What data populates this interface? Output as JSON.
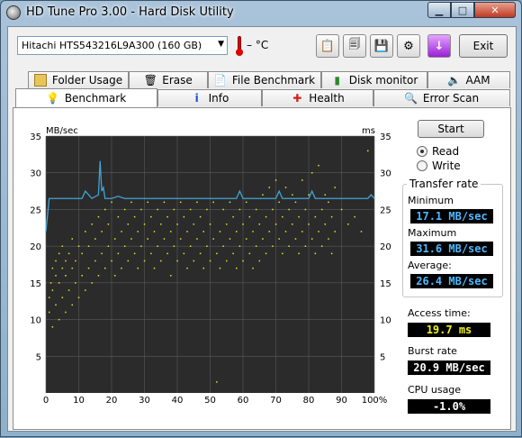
{
  "window": {
    "title": "HD Tune Pro 3.00 - Hard Disk Utility",
    "min": "▁",
    "max": "□",
    "close": "✕"
  },
  "toolbar": {
    "drive": "Hitachi HTS543216L9A300 (160 GB)",
    "temperature": "– °C",
    "exit_label": "Exit",
    "icons": [
      "copy-text-icon",
      "copy-screenshot-icon",
      "save-icon",
      "settings-icon",
      "download-icon"
    ]
  },
  "tabs": {
    "top": [
      "Folder Usage",
      "Erase",
      "File Benchmark",
      "Disk monitor",
      "AAM"
    ],
    "bottom": [
      "Benchmark",
      "Info",
      "Health",
      "Error Scan"
    ]
  },
  "benchmark": {
    "start_label": "Start",
    "read_label": "Read",
    "write_label": "Write",
    "mode": "Read",
    "transfer_rate_title": "Transfer rate",
    "minimum_label": "Minimum",
    "minimum_value": "17.1 MB/sec",
    "maximum_label": "Maximum",
    "maximum_value": "31.6 MB/sec",
    "average_label": "Average:",
    "average_value": "26.4 MB/sec",
    "access_label": "Access time:",
    "access_value": "19.7 ms",
    "burst_label": "Burst rate",
    "burst_value": "20.9 MB/sec",
    "cpu_label": "CPU usage",
    "cpu_value": "-1.0%"
  },
  "chart_data": {
    "type": "line",
    "y_left_label": "MB/sec",
    "y_right_label": "ms",
    "y_ticks": [
      5,
      10,
      15,
      20,
      25,
      30,
      35
    ],
    "x_ticks": [
      "0",
      "10",
      "20",
      "30",
      "40",
      "50",
      "60",
      "70",
      "80",
      "90",
      "100%"
    ],
    "ylim": [
      0,
      35
    ],
    "xlim": [
      0,
      100
    ],
    "colors": {
      "transfer": "#3fa4d8",
      "access": "#e6e620",
      "background": "#2b2b2b",
      "grid": "#5a5a5a"
    },
    "series": [
      {
        "x": [
          0,
          1,
          2,
          5,
          8,
          11,
          12,
          14,
          16,
          16.5,
          17,
          17.5,
          18,
          20,
          22,
          24,
          26,
          28,
          30,
          35,
          40,
          45,
          50,
          55,
          58,
          59,
          60,
          65,
          70,
          71,
          72,
          75,
          80,
          81,
          82,
          85,
          90,
          95,
          98,
          99,
          100
        ],
        "y": [
          22,
          26.5,
          26.5,
          26.5,
          26.5,
          26.5,
          27.5,
          26.5,
          27,
          31.6,
          27.5,
          28,
          26.5,
          26.5,
          26.8,
          26.5,
          26.5,
          26.5,
          26.5,
          26.5,
          26.5,
          26.5,
          26.5,
          26.5,
          26.5,
          27.5,
          26.5,
          26.5,
          26.5,
          27.5,
          26.5,
          26.5,
          26.5,
          27.5,
          26.5,
          26.5,
          26.5,
          26.5,
          26.5,
          27,
          26.5
        ]
      }
    ],
    "access_points": [
      [
        1,
        11
      ],
      [
        1,
        13
      ],
      [
        1.5,
        15
      ],
      [
        2,
        9
      ],
      [
        2,
        14
      ],
      [
        2,
        17
      ],
      [
        3,
        12
      ],
      [
        3,
        16
      ],
      [
        3,
        18
      ],
      [
        4,
        10
      ],
      [
        4,
        15
      ],
      [
        4,
        19
      ],
      [
        5,
        13
      ],
      [
        5,
        17
      ],
      [
        5,
        20
      ],
      [
        6,
        11
      ],
      [
        6,
        16
      ],
      [
        6,
        18
      ],
      [
        7,
        14
      ],
      [
        7,
        19
      ],
      [
        8,
        12
      ],
      [
        8,
        17
      ],
      [
        8,
        21
      ],
      [
        9,
        15
      ],
      [
        9,
        18
      ],
      [
        10,
        13
      ],
      [
        10,
        20
      ],
      [
        11,
        16
      ],
      [
        11,
        19
      ],
      [
        12,
        14
      ],
      [
        12,
        22
      ],
      [
        13,
        17
      ],
      [
        13,
        20
      ],
      [
        14,
        15
      ],
      [
        14,
        23
      ],
      [
        15,
        18
      ],
      [
        15,
        21
      ],
      [
        16,
        16
      ],
      [
        16,
        24
      ],
      [
        17,
        19
      ],
      [
        17,
        22
      ],
      [
        18,
        17
      ],
      [
        18,
        25
      ],
      [
        19,
        20
      ],
      [
        19,
        23
      ],
      [
        20,
        18
      ],
      [
        20,
        26
      ],
      [
        21,
        21
      ],
      [
        21,
        16
      ],
      [
        22,
        19
      ],
      [
        22,
        24
      ],
      [
        23,
        22
      ],
      [
        23,
        17
      ],
      [
        24,
        20
      ],
      [
        24,
        25
      ],
      [
        25,
        23
      ],
      [
        25,
        18
      ],
      [
        26,
        21
      ],
      [
        26,
        26
      ],
      [
        27,
        19
      ],
      [
        27,
        24
      ],
      [
        28,
        22
      ],
      [
        28,
        17
      ],
      [
        29,
        25
      ],
      [
        29,
        20
      ],
      [
        30,
        23
      ],
      [
        30,
        18
      ],
      [
        31,
        21
      ],
      [
        31,
        26
      ],
      [
        32,
        19
      ],
      [
        32,
        24
      ],
      [
        33,
        22
      ],
      [
        33,
        17
      ],
      [
        34,
        25
      ],
      [
        34,
        20
      ],
      [
        35,
        23
      ],
      [
        35,
        18
      ],
      [
        36,
        21
      ],
      [
        36,
        26
      ],
      [
        37,
        19
      ],
      [
        37,
        24
      ],
      [
        38,
        22
      ],
      [
        38,
        16
      ],
      [
        39,
        25
      ],
      [
        39,
        20
      ],
      [
        40,
        23
      ],
      [
        40,
        18
      ],
      [
        41,
        21
      ],
      [
        41,
        26
      ],
      [
        42,
        19
      ],
      [
        42,
        24
      ],
      [
        43,
        22
      ],
      [
        43,
        17
      ],
      [
        44,
        25
      ],
      [
        44,
        20
      ],
      [
        45,
        23
      ],
      [
        45,
        18
      ],
      [
        46,
        21
      ],
      [
        46,
        26
      ],
      [
        47,
        19
      ],
      [
        47,
        24
      ],
      [
        48,
        22
      ],
      [
        48,
        17
      ],
      [
        49,
        25
      ],
      [
        49,
        20
      ],
      [
        50,
        23
      ],
      [
        50,
        18
      ],
      [
        51,
        21
      ],
      [
        51,
        26
      ],
      [
        52,
        19
      ],
      [
        52,
        1.5
      ],
      [
        53,
        22
      ],
      [
        53,
        17
      ],
      [
        54,
        25
      ],
      [
        54,
        20
      ],
      [
        55,
        23
      ],
      [
        55,
        18
      ],
      [
        56,
        21
      ],
      [
        56,
        26
      ],
      [
        57,
        19
      ],
      [
        57,
        24
      ],
      [
        58,
        22
      ],
      [
        58,
        17
      ],
      [
        59,
        25
      ],
      [
        59,
        20
      ],
      [
        60,
        23
      ],
      [
        60,
        18
      ],
      [
        61,
        21
      ],
      [
        61,
        26
      ],
      [
        62,
        19
      ],
      [
        62,
        24
      ],
      [
        63,
        22
      ],
      [
        63,
        17
      ],
      [
        64,
        25
      ],
      [
        64,
        20
      ],
      [
        65,
        23
      ],
      [
        65,
        18
      ],
      [
        66,
        21
      ],
      [
        66,
        27
      ],
      [
        67,
        19
      ],
      [
        67,
        24
      ],
      [
        68,
        22
      ],
      [
        68,
        28
      ],
      [
        69,
        25
      ],
      [
        69,
        20
      ],
      [
        70,
        23
      ],
      [
        70,
        29
      ],
      [
        71,
        21
      ],
      [
        71,
        26
      ],
      [
        72,
        19
      ],
      [
        72,
        24
      ],
      [
        73,
        22
      ],
      [
        73,
        28
      ],
      [
        74,
        25
      ],
      [
        74,
        20
      ],
      [
        75,
        23
      ],
      [
        75,
        27
      ],
      [
        76,
        21
      ],
      [
        76,
        26
      ],
      [
        77,
        19
      ],
      [
        77,
        24
      ],
      [
        78,
        22
      ],
      [
        78,
        29
      ],
      [
        79,
        25
      ],
      [
        79,
        20
      ],
      [
        80,
        23
      ],
      [
        80,
        27
      ],
      [
        81,
        21
      ],
      [
        81,
        30
      ],
      [
        82,
        19
      ],
      [
        82,
        24
      ],
      [
        83,
        22
      ],
      [
        83,
        31
      ],
      [
        84,
        25
      ],
      [
        84,
        20
      ],
      [
        85,
        23
      ],
      [
        85,
        27
      ],
      [
        86,
        21
      ],
      [
        86,
        26
      ],
      [
        87,
        19
      ],
      [
        87,
        24
      ],
      [
        88,
        22
      ],
      [
        88,
        28
      ],
      [
        90,
        25
      ],
      [
        92,
        23
      ],
      [
        94,
        24
      ],
      [
        96,
        22
      ],
      [
        98,
        33
      ]
    ]
  }
}
